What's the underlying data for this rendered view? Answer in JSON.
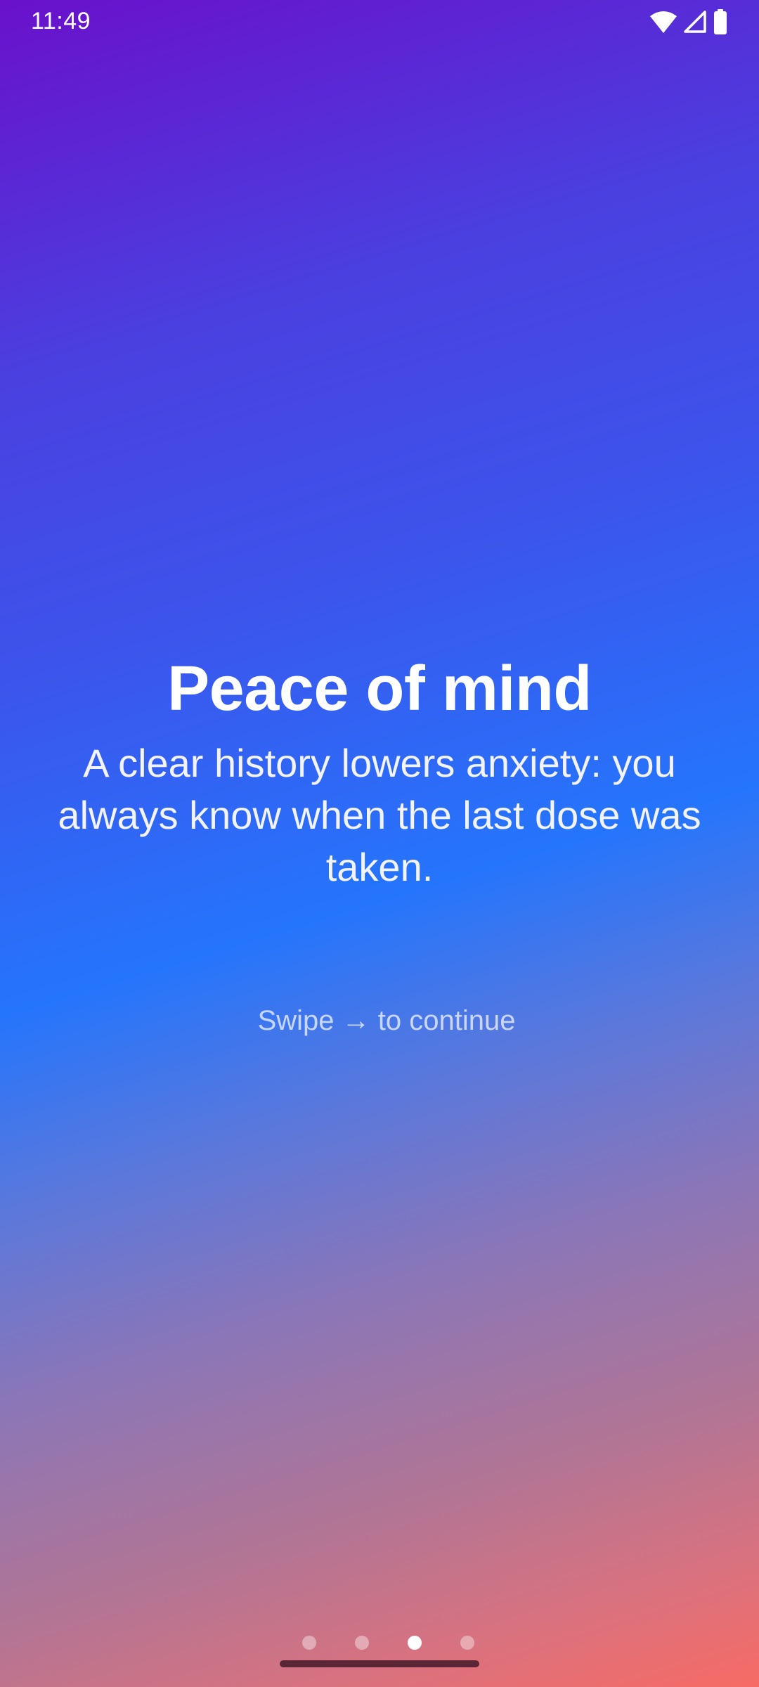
{
  "status_bar": {
    "time": "11:49",
    "icons": [
      "wifi-icon",
      "cellular-signal-icon",
      "battery-icon"
    ]
  },
  "onboarding": {
    "title": "Peace of mind",
    "description": "A clear history lowers anxiety: you always know when the last dose was taken.",
    "swipe_hint": "Swipe → to continue",
    "page_indicator": {
      "total_pages": 4,
      "current_page": 3
    }
  },
  "colors": {
    "gradient_top": "#6a11cb",
    "gradient_mid": "#2575fc",
    "gradient_bottom": "#f76b64",
    "text": "#ffffff",
    "gesture_bar": "#5a2636"
  }
}
